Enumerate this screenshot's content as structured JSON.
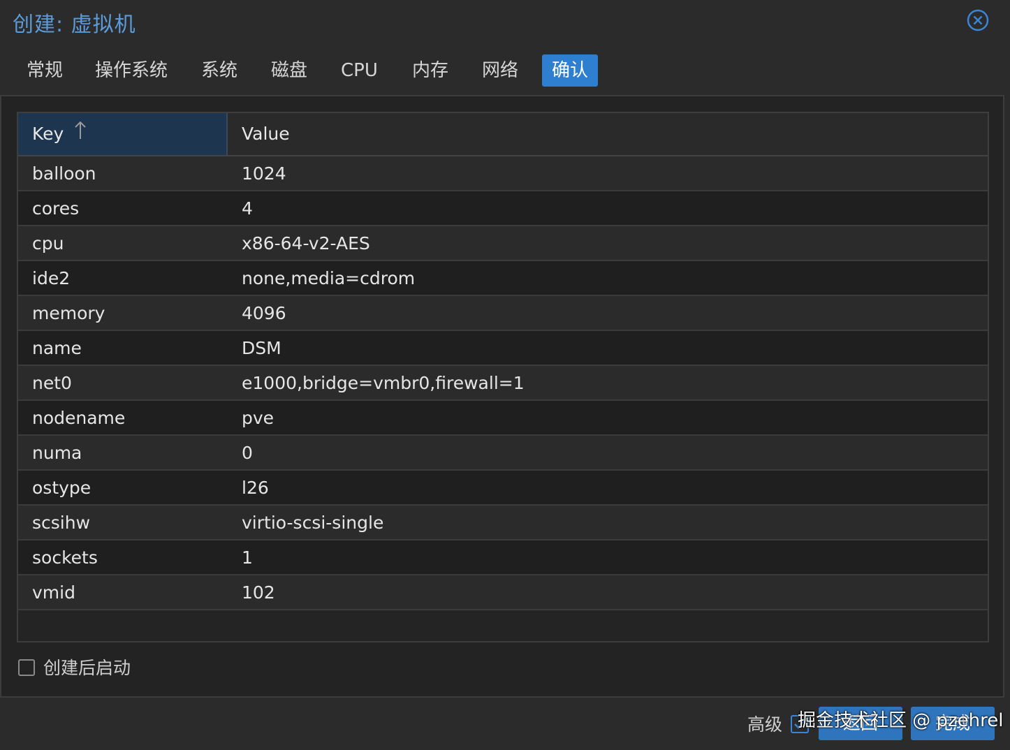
{
  "window": {
    "title": "创建: 虚拟机",
    "close_icon": "close-circle-icon"
  },
  "tabs": [
    {
      "label": "常规",
      "active": false
    },
    {
      "label": "操作系统",
      "active": false
    },
    {
      "label": "系统",
      "active": false
    },
    {
      "label": "磁盘",
      "active": false
    },
    {
      "label": "CPU",
      "active": false
    },
    {
      "label": "内存",
      "active": false
    },
    {
      "label": "网络",
      "active": false
    },
    {
      "label": "确认",
      "active": true
    }
  ],
  "grid": {
    "columns": {
      "key": "Key",
      "value": "Value"
    },
    "sort_icon": "arrow-up-icon",
    "rows": [
      {
        "key": "balloon",
        "value": "1024"
      },
      {
        "key": "cores",
        "value": "4"
      },
      {
        "key": "cpu",
        "value": "x86-64-v2-AES"
      },
      {
        "key": "ide2",
        "value": "none,media=cdrom"
      },
      {
        "key": "memory",
        "value": "4096"
      },
      {
        "key": "name",
        "value": "DSM"
      },
      {
        "key": "net0",
        "value": "e1000,bridge=vmbr0,firewall=1"
      },
      {
        "key": "nodename",
        "value": "pve"
      },
      {
        "key": "numa",
        "value": "0"
      },
      {
        "key": "ostype",
        "value": "l26"
      },
      {
        "key": "scsihw",
        "value": "virtio-scsi-single"
      },
      {
        "key": "sockets",
        "value": "1"
      },
      {
        "key": "vmid",
        "value": "102"
      }
    ]
  },
  "start_after_create": {
    "label": "创建后启动",
    "checked": false
  },
  "footer": {
    "advanced_label": "高级",
    "advanced_checked": true,
    "back_label": "返回",
    "finish_label": "完成",
    "watermark": "掘金技术社区 @ pzehrel"
  },
  "colors": {
    "accent": "#2f7fd1",
    "title": "#5a9bd8",
    "background": "#2b2b2c"
  }
}
